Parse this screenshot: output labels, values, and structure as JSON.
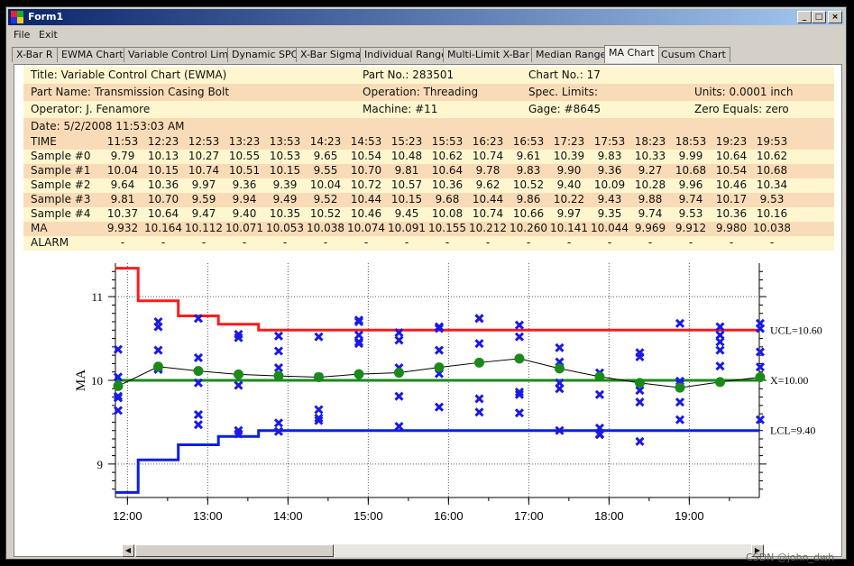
{
  "window": {
    "title": "Form1"
  },
  "menu": [
    "File",
    "Exit"
  ],
  "tabs": [
    "X-Bar R",
    "EWMA Chart",
    "Variable Control Limits",
    "Dynamic SPC",
    "X-Bar Sigma",
    "Individual Range",
    "Multi-Limit X-Bar R",
    "Median Range",
    "MA Chart",
    "Cusum Chart"
  ],
  "active_tab": "MA Chart",
  "info": {
    "title": "Title: Variable Control Chart (EWMA)",
    "part_no": "Part No.: 283501",
    "chart_no": "Chart No.: 17",
    "part_name": "Part Name: Transmission Casing Bolt",
    "operation": "Operation: Threading",
    "spec_limits": "Spec. Limits:",
    "units": "Units: 0.0001 inch",
    "operator": "Operator: J. Fenamore",
    "machine": "Machine: #11",
    "gage": "Gage: #8645",
    "zero_equals": "Zero Equals: zero",
    "date": "Date: 5/2/2008 11:53:03 AM"
  },
  "table": {
    "rows": [
      {
        "label": "TIME",
        "values": [
          "11:53",
          "12:23",
          "12:53",
          "13:23",
          "13:53",
          "14:23",
          "14:53",
          "15:23",
          "15:53",
          "16:23",
          "16:53",
          "17:23",
          "17:53",
          "18:23",
          "18:53",
          "19:23",
          "19:53"
        ]
      },
      {
        "label": "Sample #0",
        "values": [
          "9.79",
          "10.13",
          "10.27",
          "10.55",
          "10.53",
          "9.65",
          "10.54",
          "10.48",
          "10.62",
          "10.74",
          "9.61",
          "10.39",
          "9.83",
          "10.33",
          "9.99",
          "10.64",
          "10.62"
        ]
      },
      {
        "label": "Sample #1",
        "values": [
          "10.04",
          "10.15",
          "10.74",
          "10.51",
          "10.15",
          "9.55",
          "10.70",
          "9.81",
          "10.64",
          "9.78",
          "9.83",
          "9.90",
          "9.36",
          "9.27",
          "10.68",
          "10.54",
          "10.68"
        ]
      },
      {
        "label": "Sample #2",
        "values": [
          "9.64",
          "10.36",
          "9.97",
          "9.36",
          "9.39",
          "10.04",
          "10.72",
          "10.57",
          "10.36",
          "9.62",
          "10.52",
          "9.40",
          "10.09",
          "10.28",
          "9.96",
          "10.46",
          "10.34"
        ]
      },
      {
        "label": "Sample #3",
        "values": [
          "9.81",
          "10.70",
          "9.59",
          "9.94",
          "9.49",
          "9.52",
          "10.44",
          "10.15",
          "9.68",
          "10.44",
          "9.86",
          "10.22",
          "9.43",
          "9.88",
          "9.74",
          "10.17",
          "9.53"
        ]
      },
      {
        "label": "Sample #4",
        "values": [
          "10.37",
          "10.64",
          "9.47",
          "9.40",
          "10.35",
          "10.52",
          "10.46",
          "9.45",
          "10.08",
          "10.74",
          "10.66",
          "9.97",
          "9.35",
          "9.74",
          "9.53",
          "10.36",
          "10.16"
        ]
      },
      {
        "label": "MA",
        "values": [
          "9.932",
          "10.164",
          "10.112",
          "10.071",
          "10.053",
          "10.038",
          "10.074",
          "10.091",
          "10.155",
          "10.212",
          "10.260",
          "10.141",
          "10.044",
          "9.969",
          "9.912",
          "9.980",
          "10.038"
        ]
      },
      {
        "label": "ALARM",
        "values": [
          "-",
          "-",
          "-",
          "-",
          "-",
          "-",
          "-",
          "-",
          "-",
          "-",
          "-",
          "-",
          "-",
          "-",
          "-",
          "-",
          "-"
        ]
      }
    ]
  },
  "chart_data": {
    "type": "line",
    "ylabel": "MA",
    "ylim": [
      8.6,
      11.4
    ],
    "yticks": [
      9,
      10,
      11
    ],
    "xlim": [
      0,
      8.2
    ],
    "xtick_labels": [
      "12:00",
      "13:00",
      "14:00",
      "15:00",
      "16:00",
      "17:00",
      "18:00",
      "19:00"
    ],
    "sample_times": [
      "11:53",
      "12:23",
      "12:53",
      "13:23",
      "13:53",
      "14:23",
      "14:53",
      "15:23",
      "15:53",
      "16:23",
      "16:53",
      "17:23",
      "17:53",
      "18:23",
      "18:53",
      "19:23",
      "19:53"
    ],
    "samples": [
      [
        9.79,
        10.04,
        9.64,
        9.81,
        10.37
      ],
      [
        10.13,
        10.15,
        10.36,
        10.7,
        10.64
      ],
      [
        10.27,
        10.74,
        9.97,
        9.59,
        9.47
      ],
      [
        10.55,
        10.51,
        9.36,
        9.94,
        9.4
      ],
      [
        10.53,
        10.15,
        9.39,
        9.49,
        10.35
      ],
      [
        9.65,
        9.55,
        10.04,
        9.52,
        10.52
      ],
      [
        10.54,
        10.7,
        10.72,
        10.44,
        10.46
      ],
      [
        10.48,
        9.81,
        10.57,
        10.15,
        9.45
      ],
      [
        10.62,
        10.64,
        10.36,
        9.68,
        10.08
      ],
      [
        10.74,
        9.78,
        9.62,
        10.44,
        10.74
      ],
      [
        9.61,
        9.83,
        10.52,
        9.86,
        10.66
      ],
      [
        10.39,
        9.9,
        9.4,
        10.22,
        9.97
      ],
      [
        9.83,
        9.36,
        10.09,
        9.43,
        9.35
      ],
      [
        10.33,
        9.27,
        10.28,
        9.88,
        9.74
      ],
      [
        9.99,
        10.68,
        9.96,
        9.74,
        9.53
      ],
      [
        10.64,
        10.54,
        10.46,
        10.17,
        10.36
      ],
      [
        10.62,
        10.68,
        10.34,
        9.53,
        10.16
      ]
    ],
    "ma": [
      9.932,
      10.164,
      10.112,
      10.071,
      10.053,
      10.038,
      10.074,
      10.091,
      10.155,
      10.212,
      10.26,
      10.141,
      10.044,
      9.969,
      9.912,
      9.98,
      10.038
    ],
    "center": 10.0,
    "ucl_steps": [
      11.34,
      10.95,
      10.77,
      10.67,
      10.6
    ],
    "lcl_steps": [
      8.66,
      9.05,
      9.23,
      9.33,
      9.4
    ],
    "limit_labels": {
      "ucl": "UCL=10.60",
      "center": "X=10.00",
      "lcl": "LCL=9.40"
    },
    "colors": {
      "ucl": "#ff1a1a",
      "lcl": "#0a1ee6",
      "center": "#1a8a1a",
      "samples": "#1a1ae6",
      "ma": "#1a8a1a"
    }
  },
  "watermark": "CSDN @john_dwh"
}
